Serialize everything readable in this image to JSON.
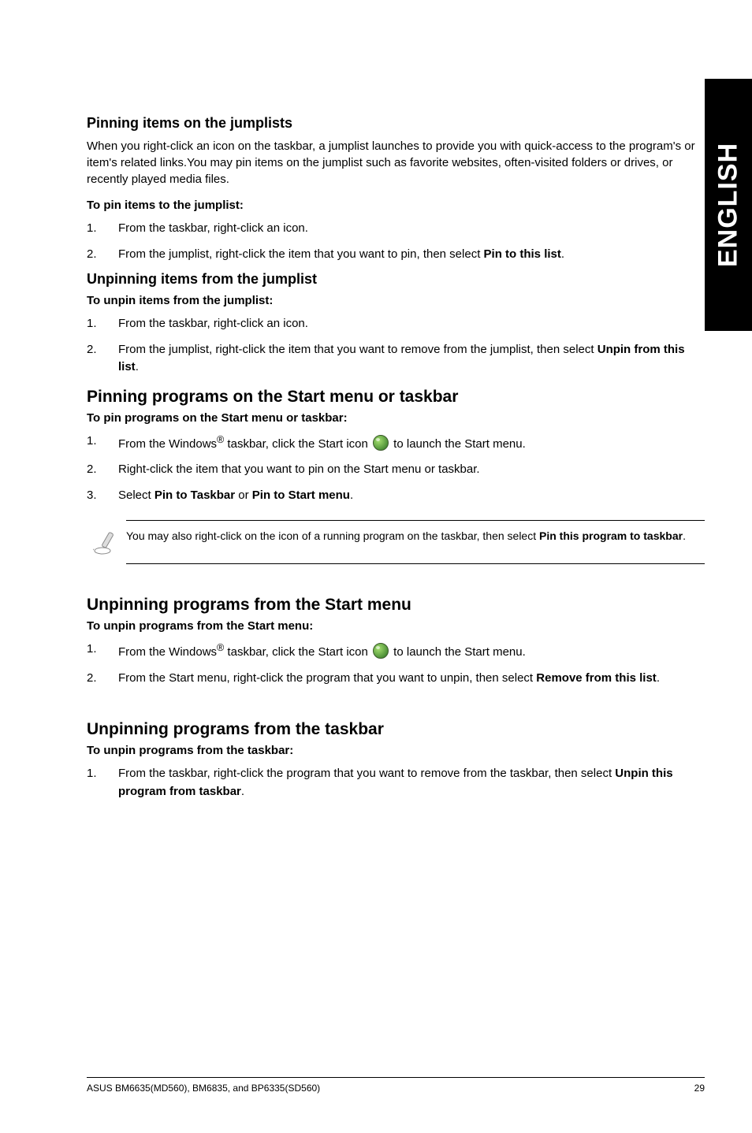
{
  "side_tab": "ENGLISH",
  "s1": {
    "title": "Pinning items on the jumplists",
    "intro": "When you right-click an icon on the taskbar, a jumplist launches to provide you with quick-access to the program's or item's related links.You may pin items on the jumplist such as favorite websites, often-visited folders or drives, or recently played media files.",
    "sub": "To pin items to the jumplist:",
    "step1": "From the taskbar, right-click an icon.",
    "step2_a": "From the jumplist, right-click the item that you want to pin, then select ",
    "step2_b": "Pin to this list",
    "step2_c": "."
  },
  "s2": {
    "title": "Unpinning items from the jumplist",
    "sub": "To unpin items from the jumplist:",
    "step1": "From the taskbar, right-click an icon.",
    "step2_a": "From the jumplist, right-click the item that you want to remove from the jumplist, then select ",
    "step2_b": "Unpin from this list",
    "step2_c": "."
  },
  "s3": {
    "title": "Pinning programs on the Start menu or taskbar",
    "sub": "To pin programs on the Start menu or taskbar:",
    "step1_a": "From the Windows",
    "step1_b": " taskbar, click the Start icon ",
    "step1_c": " to launch the Start menu.",
    "step2": "Right-click the item that you want to pin on the Start menu or taskbar.",
    "step3_a": "Select ",
    "step3_b": "Pin to Taskbar",
    "step3_c": " or ",
    "step3_d": "Pin to Start menu",
    "step3_e": ".",
    "note_a": "You may also right-click on the icon of a running program on the taskbar, then select ",
    "note_b": "Pin this program to taskbar",
    "note_c": "."
  },
  "s4": {
    "title": "Unpinning programs from the Start menu",
    "sub": "To unpin programs from the Start menu:",
    "step1_a": "From the Windows",
    "step1_b": " taskbar, click the Start icon ",
    "step1_c": " to launch the Start menu.",
    "step2_a": "From the Start menu, right-click the program that you want to unpin, then select ",
    "step2_b": "Remove from this list",
    "step2_c": "."
  },
  "s5": {
    "title": "Unpinning programs from the taskbar",
    "sub": "To unpin programs from the taskbar:",
    "step1_a": "From the taskbar, right-click the program that you want to remove from the taskbar, then select ",
    "step1_b": "Unpin this program from taskbar",
    "step1_c": "."
  },
  "footer": {
    "left": "ASUS BM6635(MD560), BM6835, and BP6335(SD560)",
    "right": "29"
  },
  "reg_mark": "®"
}
